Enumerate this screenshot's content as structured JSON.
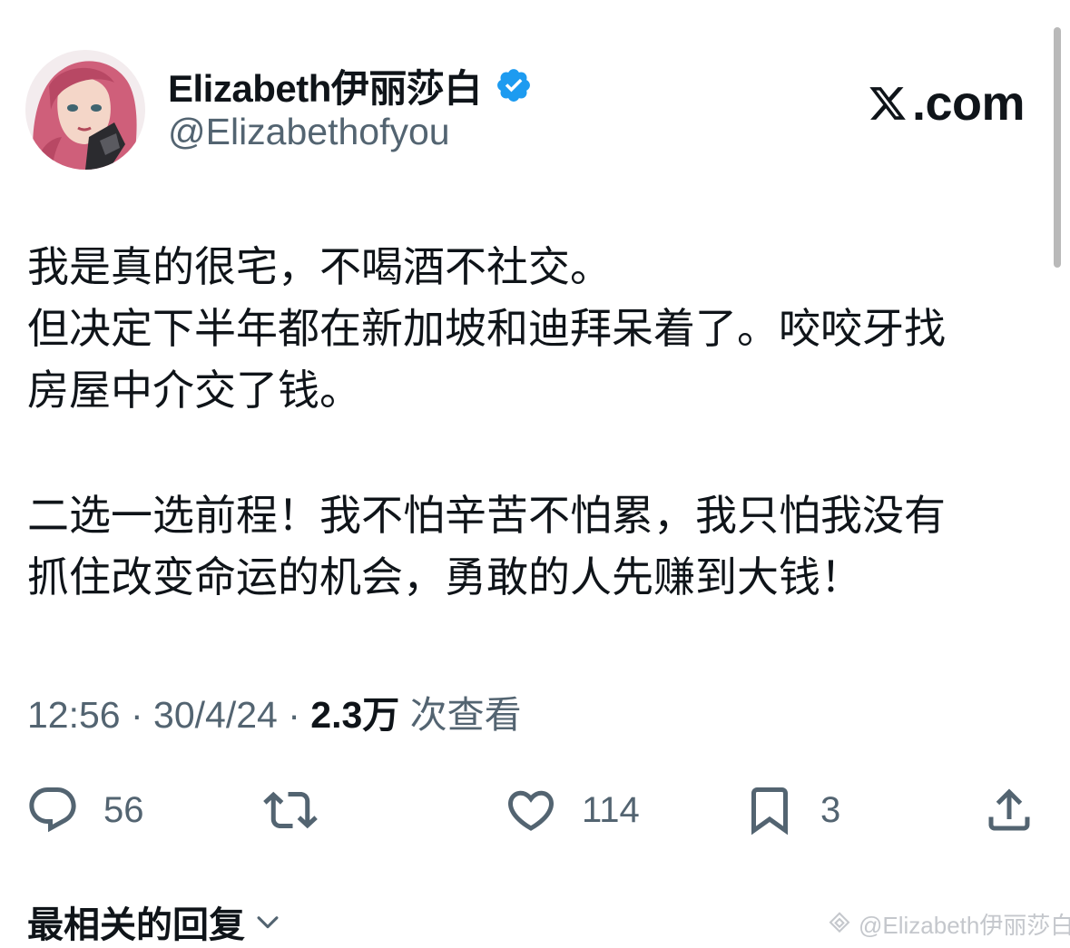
{
  "author": {
    "display_name": "Elizabeth伊丽莎白",
    "handle": "@Elizabethofyou",
    "verified": true,
    "verified_color": "#1d9bf0"
  },
  "brand": {
    "text": ".com"
  },
  "tweet": {
    "lines": [
      "我是真的很宅，不喝酒不社交。",
      "但决定下半年都在新加坡和迪拜呆着了。咬咬牙找",
      "房屋中介交了钱。",
      "",
      "二选一选前程！我不怕辛苦不怕累，我只怕我没有",
      "抓住改变命运的机会，勇敢的人先赚到大钱！"
    ]
  },
  "meta": {
    "time": "12:56",
    "separator": " · ",
    "date": "30/4/24",
    "views_count": "2.3万",
    "views_label": " 次查看"
  },
  "actions": {
    "replies": "56",
    "likes": "114",
    "bookmarks": "3"
  },
  "replies_section": {
    "sort_label": "最相关的回复"
  },
  "watermark": {
    "text": "@Elizabeth伊丽莎白"
  },
  "colors": {
    "text_primary": "#0f1419",
    "text_secondary": "#536471",
    "accent": "#1d9bf0"
  }
}
